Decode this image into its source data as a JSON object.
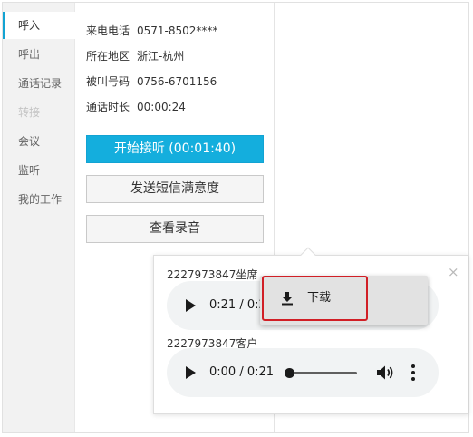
{
  "sidebar": {
    "items": [
      {
        "label": "呼入",
        "state": "active"
      },
      {
        "label": "呼出",
        "state": "normal"
      },
      {
        "label": "通话记录",
        "state": "normal"
      },
      {
        "label": "转接",
        "state": "disabled"
      },
      {
        "label": "会议",
        "state": "normal"
      },
      {
        "label": "监听",
        "state": "normal"
      },
      {
        "label": "我的工作",
        "state": "normal"
      }
    ]
  },
  "call_info": {
    "caller_label": "来电电话",
    "caller_value": "0571-8502****",
    "region_label": "所在地区",
    "region_value": "浙江-杭州",
    "callee_label": "被叫号码",
    "callee_value": "0756-6701156",
    "duration_label": "通话时长",
    "duration_value": "00:00:24"
  },
  "buttons": {
    "answer": "开始接听 (00:01:40)",
    "send_sms": "发送短信满意度",
    "view_recording": "查看录音"
  },
  "recordings": {
    "close_glyph": "×",
    "tracks": [
      {
        "title": "2227973847坐席",
        "time": "0:21 / 0:21",
        "progress": 1.0
      },
      {
        "title": "2227973847客户",
        "time": "0:00 / 0:21",
        "progress": 0.0
      }
    ]
  },
  "context_menu": {
    "download_label": "下载",
    "download_icon": "download-icon"
  },
  "colors": {
    "accent": "#14aedd",
    "highlight_box": "#d11f26",
    "sidebar_bg": "#f2f2f2"
  }
}
